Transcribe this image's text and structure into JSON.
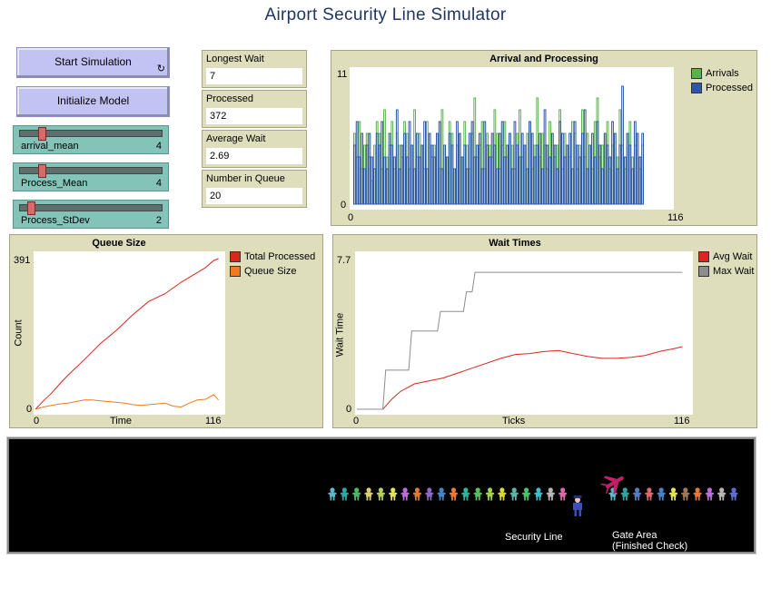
{
  "title": "Airport Security Line Simulator",
  "buttons": {
    "start": "Start Simulation",
    "init": "Initialize Model",
    "forever_glyph": "↻"
  },
  "sliders": [
    {
      "label": "arrival_mean",
      "value": "4",
      "fraction": 0.13
    },
    {
      "label": "Process_Mean",
      "value": "4",
      "fraction": 0.13
    },
    {
      "label": "Process_StDev",
      "value": "2",
      "fraction": 0.05
    }
  ],
  "monitors": [
    {
      "label": "Longest Wait",
      "value": "7"
    },
    {
      "label": "Processed",
      "value": "372"
    },
    {
      "label": "Average Wait",
      "value": "2.69"
    },
    {
      "label": "Number in Queue",
      "value": "20"
    }
  ],
  "colors": {
    "arrivals": "#58b24a",
    "processed": "#2d55a8",
    "total_processed": "#d9261f",
    "queue_size": "#f07a1d",
    "avg_wait": "#d9261f",
    "max_wait": "#8c8c8c"
  },
  "chart_data": [
    {
      "type": "bar",
      "title": "Arrival and Processing",
      "xlabel": "",
      "ylabel": "",
      "xlim": [
        0,
        116
      ],
      "ylim": [
        0,
        11
      ],
      "x_tick_labels": [
        "0",
        "116"
      ],
      "y_tick_labels": [
        "0",
        "11"
      ],
      "legend_position": "top-right",
      "series": [
        {
          "name": "Arrivals",
          "values": [
            6,
            4,
            7,
            3,
            5,
            6,
            4,
            2,
            5,
            7,
            6,
            3,
            8,
            4,
            5,
            7,
            3,
            6,
            5,
            4,
            7,
            6,
            3,
            5,
            8,
            4,
            6,
            5,
            3,
            7,
            6,
            4,
            5,
            6,
            3,
            8,
            5,
            4,
            7,
            6,
            3,
            5,
            6,
            4,
            7,
            5,
            3,
            6,
            9,
            4,
            5,
            7,
            3,
            6,
            5,
            4,
            8,
            6,
            3,
            5,
            7,
            4,
            6,
            5,
            3,
            6,
            8,
            4,
            5,
            6,
            7,
            3,
            5,
            9,
            4,
            6,
            5,
            3,
            7,
            6,
            4,
            5,
            8,
            3,
            6,
            5,
            4,
            7,
            6,
            3,
            5,
            8,
            4,
            6,
            5,
            3,
            7,
            9,
            4,
            5,
            6,
            7,
            3,
            5,
            6,
            4,
            8,
            5,
            3,
            6,
            7,
            4,
            5,
            6,
            3,
            5
          ]
        },
        {
          "name": "Processed",
          "values": [
            5,
            7,
            4,
            6,
            3,
            5,
            6,
            4,
            3,
            6,
            5,
            7,
            4,
            3,
            6,
            5,
            4,
            8,
            3,
            5,
            6,
            4,
            7,
            5,
            3,
            6,
            4,
            5,
            7,
            3,
            6,
            5,
            4,
            6,
            7,
            3,
            5,
            4,
            6,
            5,
            3,
            7,
            6,
            4,
            5,
            3,
            6,
            7,
            4,
            5,
            6,
            3,
            7,
            5,
            4,
            6,
            5,
            3,
            6,
            7,
            4,
            5,
            6,
            3,
            7,
            5,
            4,
            6,
            5,
            3,
            7,
            6,
            4,
            5,
            6,
            3,
            8,
            5,
            4,
            6,
            5,
            3,
            7,
            6,
            4,
            5,
            6,
            3,
            7,
            5,
            4,
            6,
            8,
            3,
            5,
            6,
            4,
            7,
            5,
            3,
            6,
            5,
            4,
            7,
            6,
            3,
            5,
            10,
            4,
            6,
            5,
            3,
            7,
            6,
            4,
            6
          ]
        }
      ]
    },
    {
      "type": "line",
      "title": "Queue Size",
      "xlabel": "Time",
      "ylabel": "Count",
      "xlim": [
        0,
        116
      ],
      "ylim": [
        0,
        391
      ],
      "x_tick_labels": [
        "0",
        "116"
      ],
      "y_tick_labels": [
        "0",
        "391"
      ],
      "legend_position": "top-right",
      "series": [
        {
          "name": "Total Processed",
          "x": [
            0,
            5,
            10,
            15,
            20,
            30,
            40,
            50,
            60,
            70,
            80,
            90,
            100,
            105,
            110,
            113
          ],
          "y": [
            0,
            22,
            42,
            66,
            88,
            128,
            170,
            205,
            245,
            280,
            300,
            330,
            355,
            368,
            386,
            391
          ]
        },
        {
          "name": "Queue Size",
          "x": [
            0,
            5,
            10,
            15,
            20,
            25,
            30,
            35,
            40,
            45,
            50,
            55,
            60,
            65,
            70,
            75,
            80,
            85,
            90,
            95,
            100,
            105,
            110,
            113
          ],
          "y": [
            0,
            6,
            10,
            14,
            16,
            20,
            24,
            24,
            22,
            20,
            18,
            16,
            12,
            10,
            12,
            14,
            16,
            8,
            6,
            16,
            24,
            26,
            38,
            24
          ]
        }
      ]
    },
    {
      "type": "line",
      "title": "Wait Times",
      "xlabel": "Ticks",
      "ylabel": "Wait Time",
      "xlim": [
        0,
        116
      ],
      "ylim": [
        0,
        7.7
      ],
      "x_tick_labels": [
        "0",
        "116"
      ],
      "y_tick_labels": [
        "0",
        "7.7"
      ],
      "legend_position": "top-right",
      "series": [
        {
          "name": "Avg Wait",
          "x": [
            0,
            9,
            12,
            15,
            20,
            30,
            40,
            50,
            55,
            60,
            65,
            70,
            75,
            80,
            85,
            90,
            95,
            100,
            105,
            110,
            113
          ],
          "y": [
            0,
            0,
            0.5,
            0.9,
            1.3,
            1.6,
            2.1,
            2.6,
            2.8,
            2.85,
            2.95,
            3.0,
            2.85,
            2.7,
            2.6,
            2.6,
            2.65,
            2.75,
            2.95,
            3.1,
            3.2
          ]
        },
        {
          "name": "Max Wait",
          "x": [
            0,
            9,
            10,
            18,
            19,
            28,
            29,
            37,
            38,
            40,
            41,
            113
          ],
          "y": [
            0,
            0,
            2.0,
            2.0,
            4.0,
            4.0,
            5.0,
            5.0,
            6.0,
            6.0,
            7.0,
            7.0
          ]
        }
      ]
    }
  ],
  "world": {
    "security_label": "Security Line",
    "gate_label_line1": "Gate Area",
    "gate_label_line2": "(Finished Check)",
    "queue_colors": [
      "#5fb6c8",
      "#2fa6a0",
      "#4bb861",
      "#d9d06a",
      "#b6cc5c",
      "#e3e35a",
      "#b96fd6",
      "#e07a35",
      "#8a6ac6",
      "#4683c8",
      "#ee7a33",
      "#2bb59a",
      "#56c05a",
      "#a3d14d",
      "#d8d83e",
      "#58b7a8",
      "#49c26d",
      "#3cbfc9",
      "#bab6b6",
      "#d96ba7"
    ],
    "gate_colors": [
      "#5fb6c8",
      "#2fa6a0",
      "#5a7bc4",
      "#d96b6b",
      "#4683c8",
      "#e3e35a",
      "#a1785a",
      "#e07a35",
      "#b96fd6",
      "#bab6b6",
      "#5d6ed6"
    ],
    "officer_color": "#3c4fb5",
    "plane_color": "#c2206a"
  }
}
